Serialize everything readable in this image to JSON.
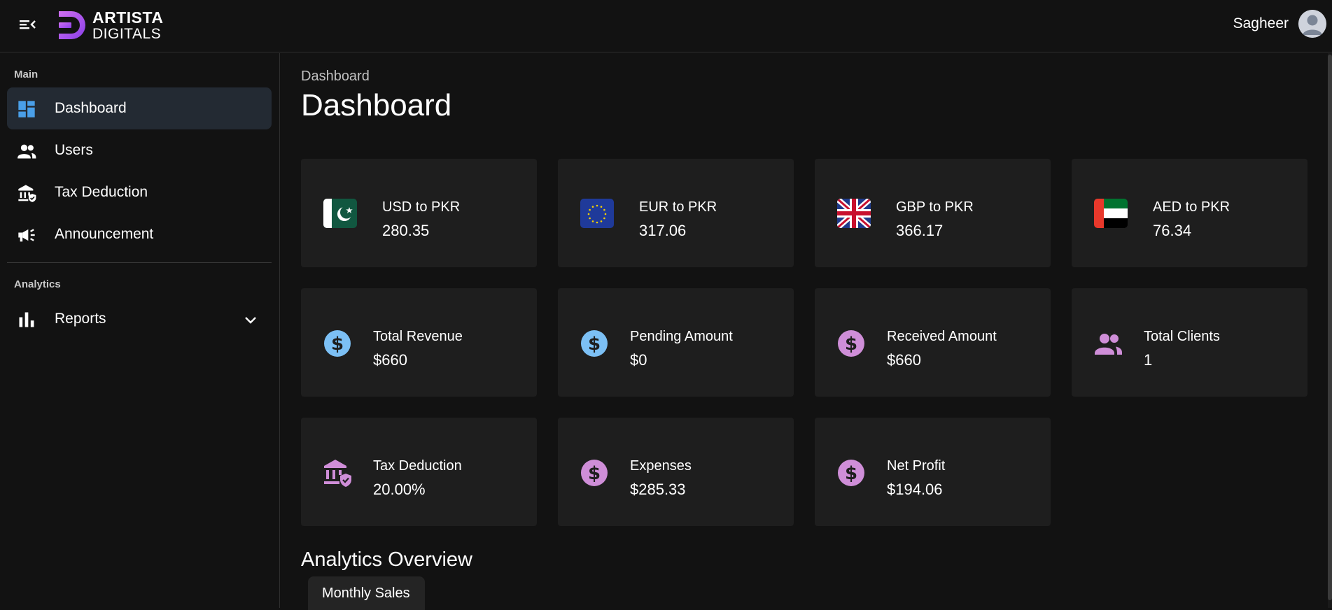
{
  "header": {
    "logo_line1": "ARTISTA",
    "logo_line2": "DIGITALS",
    "user_name": "Sagheer",
    "accent": "#a855f7"
  },
  "sidebar": {
    "sections": [
      {
        "label": "Main",
        "items": [
          {
            "label": "Dashboard",
            "icon": "dashboard-icon",
            "active": true
          },
          {
            "label": "Users",
            "icon": "users-icon"
          },
          {
            "label": "Tax Deduction",
            "icon": "bank-shield-icon"
          },
          {
            "label": "Announcement",
            "icon": "megaphone-icon"
          }
        ]
      },
      {
        "label": "Analytics",
        "items": [
          {
            "label": "Reports",
            "icon": "bar-chart-icon",
            "expandable": true
          }
        ]
      }
    ]
  },
  "main": {
    "breadcrumb": "Dashboard",
    "title": "Dashboard",
    "exchange_rates": [
      {
        "label": "USD to PKR",
        "value": "280.35",
        "icon": "pakistan-flag-icon"
      },
      {
        "label": "EUR to PKR",
        "value": "317.06",
        "icon": "eu-flag-icon"
      },
      {
        "label": "GBP to PKR",
        "value": "366.17",
        "icon": "uk-flag-icon"
      },
      {
        "label": "AED to PKR",
        "value": "76.34",
        "icon": "uae-flag-icon"
      }
    ],
    "stats": [
      {
        "label": "Total Revenue",
        "value": "$660",
        "icon": "dollar-circle-icon",
        "color": "#7cc0f5"
      },
      {
        "label": "Pending Amount",
        "value": "$0",
        "icon": "dollar-circle-icon",
        "color": "#7cc0f5"
      },
      {
        "label": "Received Amount",
        "value": "$660",
        "icon": "dollar-circle-icon",
        "color": "#cf8ed8"
      },
      {
        "label": "Total Clients",
        "value": "1",
        "icon": "users-icon",
        "color": "#cf8ed8"
      },
      {
        "label": "Tax Deduction",
        "value": "20.00%",
        "icon": "bank-shield-icon",
        "color": "#cf8ed8"
      },
      {
        "label": "Expenses",
        "value": "$285.33",
        "icon": "dollar-circle-icon",
        "color": "#cf8ed8"
      },
      {
        "label": "Net Profit",
        "value": "$194.06",
        "icon": "dollar-circle-icon",
        "color": "#cf8ed8"
      }
    ],
    "analytics_title": "Analytics Overview",
    "tabs": [
      {
        "label": "Monthly Sales"
      }
    ]
  }
}
